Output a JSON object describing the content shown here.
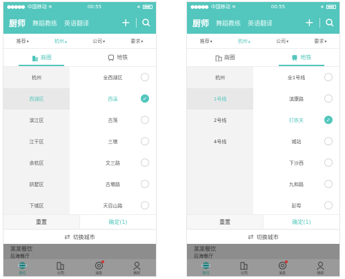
{
  "colors": {
    "accent": "#53c6bd",
    "dim_overlay": "#8d8d8d"
  },
  "status": {
    "carrier": "中国移动",
    "wifi": "wifi-icon",
    "time": "00:55",
    "battery": "battery-icon"
  },
  "nav": {
    "tabs": [
      "厨师",
      "舞蹈教练",
      "英语翻译"
    ],
    "plus": "+",
    "search_icon": "search-icon"
  },
  "filters": {
    "recommend": "推荐",
    "city": "杭州",
    "company": "公司",
    "require": "要求"
  },
  "typetabs": {
    "business": "商圈",
    "metro": "地铁"
  },
  "screens": [
    {
      "left": [
        "杭州",
        "西湖区",
        "滨江区",
        "江干区",
        "余杭区",
        "拱墅区",
        "下城区"
      ],
      "left_active": 1,
      "right": [
        "全西湖区",
        "西溪",
        "古荡",
        "三墩",
        "文三路",
        "古墩路",
        "天目山路"
      ],
      "right_active": 1
    },
    {
      "left": [
        "杭州",
        "1号线",
        "2号线",
        "4号线"
      ],
      "left_active": 1,
      "right": [
        "全1号线",
        "滨康路",
        "打铁关",
        "城站",
        "下沙西",
        "九和路",
        "彭埠"
      ],
      "right_active": 2
    }
  ],
  "actions": {
    "reset": "重置",
    "confirm": "确定(1)"
  },
  "switch_city": "切换城市",
  "behind": {
    "title": "某某餐饮",
    "sub": "后海餐厅"
  },
  "tabbar": [
    "职位",
    "公司",
    "消息",
    "我的"
  ]
}
